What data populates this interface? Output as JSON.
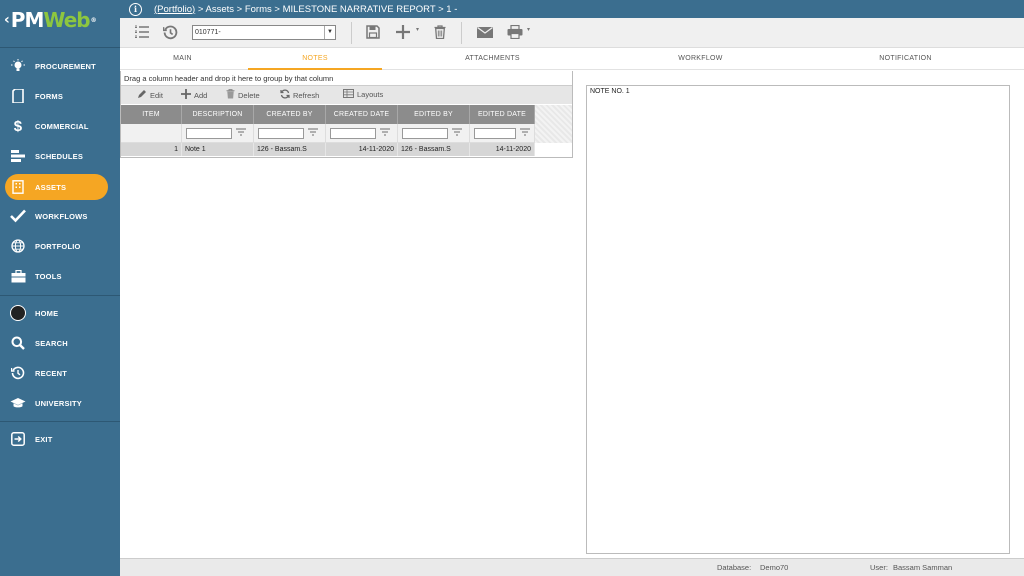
{
  "logo": {
    "left": "PM",
    "right": "Web",
    "reg": "®"
  },
  "nav": [
    {
      "label": "PROCUREMENT",
      "icon": "lightbulb-icon"
    },
    {
      "label": "FORMS",
      "icon": "document-icon"
    },
    {
      "label": "COMMERCIAL",
      "icon": "dollar-icon"
    },
    {
      "label": "SCHEDULES",
      "icon": "gantt-icon"
    },
    {
      "label": "ASSETS",
      "icon": "building-icon"
    },
    {
      "label": "WORKFLOWS",
      "icon": "checkmark-icon"
    },
    {
      "label": "PORTFOLIO",
      "icon": "globe-icon"
    },
    {
      "label": "TOOLS",
      "icon": "toolbox-icon"
    },
    {
      "label": "HOME",
      "icon": "avatar-icon"
    },
    {
      "label": "SEARCH",
      "icon": "search-icon"
    },
    {
      "label": "RECENT",
      "icon": "history-icon"
    },
    {
      "label": "UNIVERSITY",
      "icon": "graduation-cap-icon"
    },
    {
      "label": "EXIT",
      "icon": "exit-icon"
    }
  ],
  "active_nav": "ASSETS",
  "breadcrumb": {
    "portfolio": "(Portfolio)",
    "rest": " > Assets > Forms > MILESTONE NARRATIVE REPORT > 1 -"
  },
  "toolbar": {
    "record_value": "010771-"
  },
  "tabs": [
    "MAIN",
    "NOTES",
    "ATTACHMENTS",
    "WORKFLOW",
    "NOTIFICATION"
  ],
  "active_tab": "NOTES",
  "grid": {
    "group_hint": "Drag a column header and drop it here to group by that column",
    "tools": {
      "edit": "Edit",
      "add": "Add",
      "delete": "Delete",
      "refresh": "Refresh",
      "layouts": "Layouts"
    },
    "columns": [
      "ITEM",
      "DESCRIPTION",
      "CREATED BY",
      "CREATED DATE",
      "EDITED BY",
      "EDITED DATE"
    ],
    "rows": [
      {
        "item": "1",
        "description": "Note 1",
        "created_by": "126 - Bassam.S",
        "created_date": "14-11-2020",
        "edited_by": "126 - Bassam.S",
        "edited_date": "14-11-2020"
      }
    ]
  },
  "preview": {
    "text": "NOTE NO. 1"
  },
  "status": {
    "db_label": "Database:",
    "db_value": "Demo70",
    "user_label": "User:",
    "user_value": "Bassam Samman"
  },
  "colors": {
    "sidebar": "#3b6e8f",
    "accent": "#f5a623",
    "logo_green": "#8dc63f"
  }
}
